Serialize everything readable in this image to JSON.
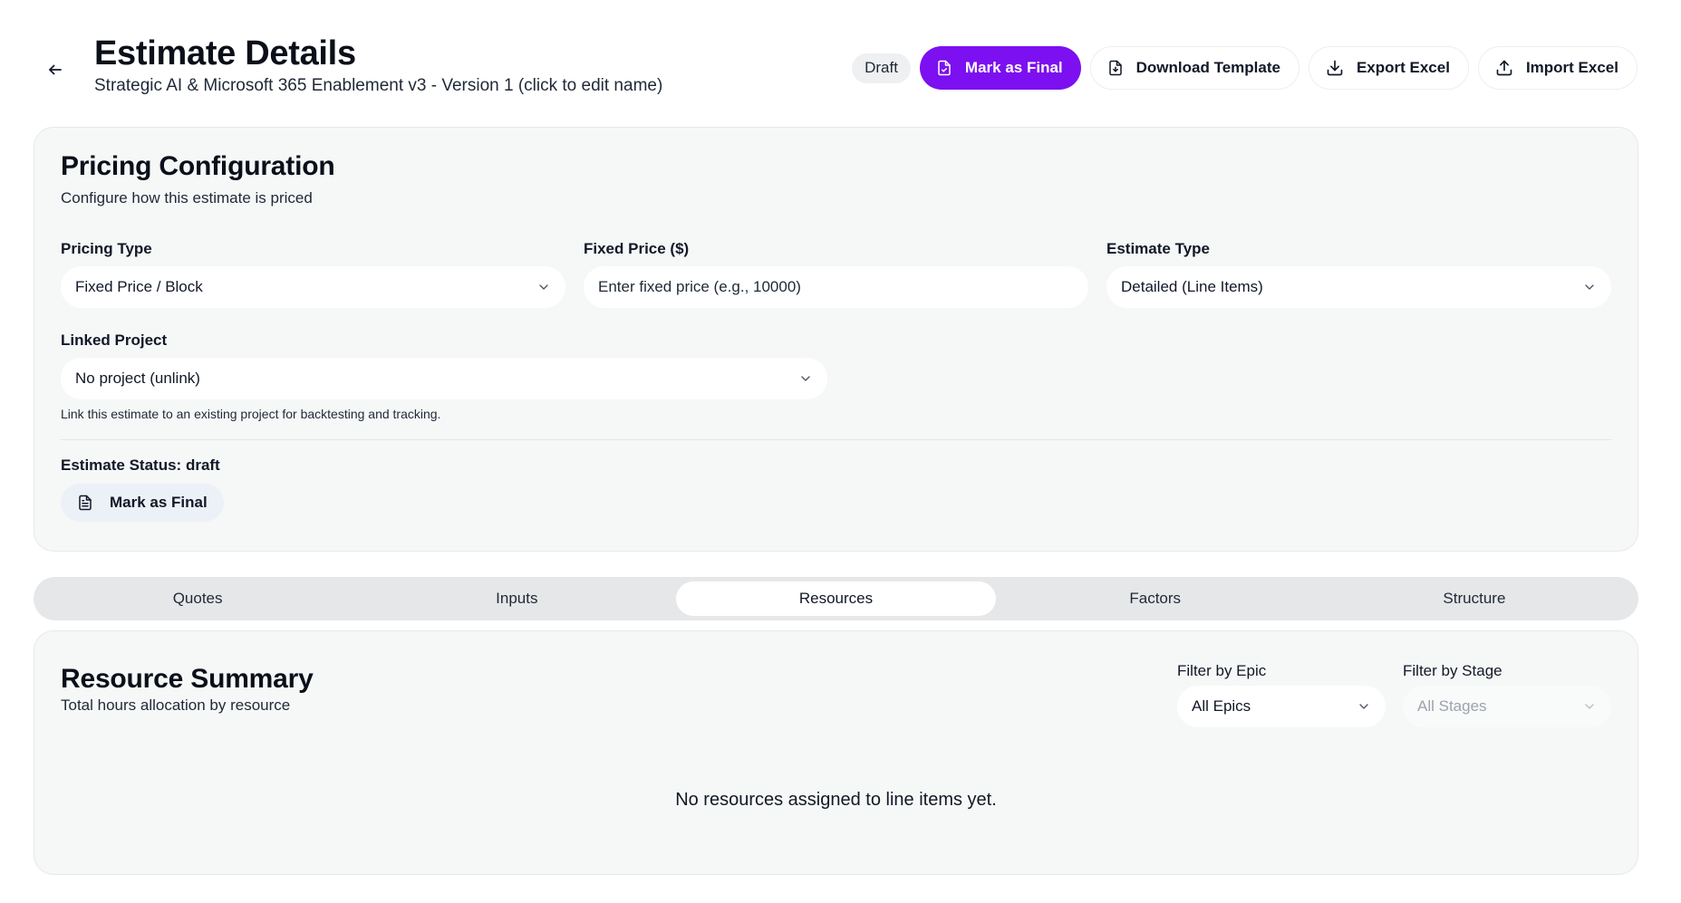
{
  "header": {
    "title": "Estimate Details",
    "subtitle": "Strategic AI & Microsoft 365 Enablement v3 - Version 1 (click to edit name)",
    "badge": "Draft",
    "mark_final_label": "Mark as Final",
    "download_template_label": "Download Template",
    "export_excel_label": "Export Excel",
    "import_excel_label": "Import Excel",
    "accent_color": "#7c10f0"
  },
  "pricing": {
    "title": "Pricing Configuration",
    "description": "Configure how this estimate is priced",
    "pricing_type": {
      "label": "Pricing Type",
      "value": "Fixed Price / Block"
    },
    "fixed_price": {
      "label": "Fixed Price ($)",
      "placeholder": "Enter fixed price (e.g., 10000)"
    },
    "estimate_type": {
      "label": "Estimate Type",
      "value": "Detailed (Line Items)"
    },
    "linked_project": {
      "label": "Linked Project",
      "value": "No project (unlink)",
      "helper": "Link this estimate to an existing project for backtesting and tracking."
    },
    "status_label": "Estimate Status:",
    "status_value": "draft",
    "mark_final_label": "Mark as Final"
  },
  "tabs": [
    {
      "label": "Quotes",
      "active": false
    },
    {
      "label": "Inputs",
      "active": false
    },
    {
      "label": "Resources",
      "active": true
    },
    {
      "label": "Factors",
      "active": false
    },
    {
      "label": "Structure",
      "active": false
    }
  ],
  "resource_summary": {
    "title": "Resource Summary",
    "description": "Total hours allocation by resource",
    "filter_epic": {
      "label": "Filter by Epic",
      "value": "All Epics"
    },
    "filter_stage": {
      "label": "Filter by Stage",
      "value": "All Stages"
    },
    "empty_message": "No resources assigned to line items yet."
  }
}
